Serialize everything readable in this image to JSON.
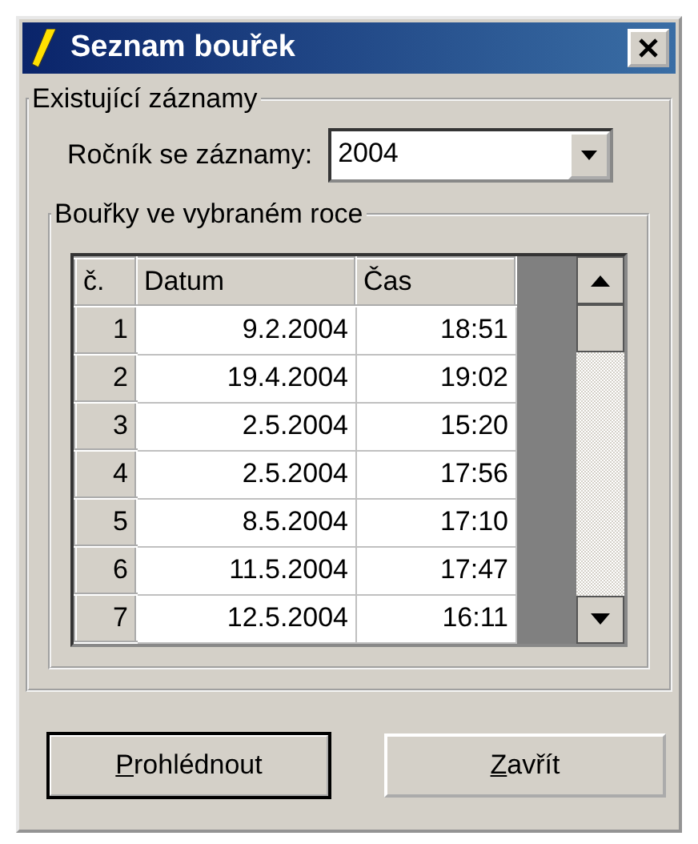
{
  "window": {
    "title": "Seznam bouřek"
  },
  "records_group": {
    "title": "Existující záznamy",
    "year_label": "Ročník se záznamy:",
    "year_value": "2004"
  },
  "storms_group": {
    "title": "Bouřky ve vybraném roce",
    "table": {
      "columns": [
        "č.",
        "Datum",
        "Čas"
      ],
      "rows": [
        {
          "number": "1",
          "date": "9.2.2004",
          "time": "18:51"
        },
        {
          "number": "2",
          "date": "19.4.2004",
          "time": "19:02"
        },
        {
          "number": "3",
          "date": "2.5.2004",
          "time": "15:20"
        },
        {
          "number": "4",
          "date": "2.5.2004",
          "time": "17:56"
        },
        {
          "number": "5",
          "date": "8.5.2004",
          "time": "17:10"
        },
        {
          "number": "6",
          "date": "11.5.2004",
          "time": "17:47"
        },
        {
          "number": "7",
          "date": "12.5.2004",
          "time": "16:11"
        }
      ]
    }
  },
  "buttons": [
    {
      "accelerator": "P",
      "rest": "rohlédnout",
      "default": true
    },
    {
      "accelerator": "Z",
      "rest": "avřít",
      "default": false
    }
  ]
}
